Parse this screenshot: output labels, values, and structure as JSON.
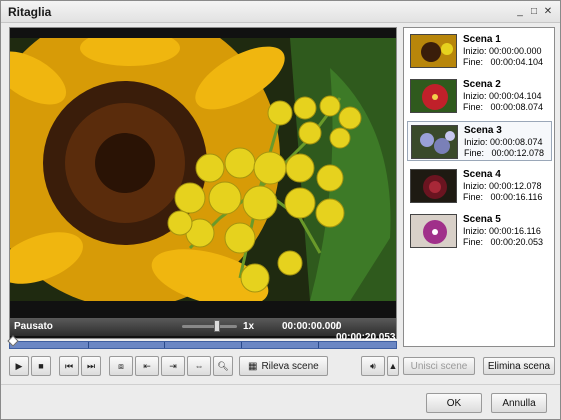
{
  "window": {
    "title": "Ritaglia",
    "buttons": {
      "minimize": "_",
      "maximize": "□",
      "close": "✕"
    }
  },
  "player": {
    "state": "Pausato",
    "speed": "1x",
    "current_time": "00:00:00.000",
    "total_time": "/ 00:00:20.053",
    "speed_level": 0.6
  },
  "controls": {
    "detect_scenes_label": "Rileva scene"
  },
  "scenes": [
    {
      "name": "Scena 1",
      "start": "Inizio: 00:00:00.000",
      "end": "Fine:   00:00:04.104",
      "thumb_color": "#b8860b"
    },
    {
      "name": "Scena 2",
      "start": "Inizio: 00:00:04.104",
      "end": "Fine:   00:00:08.074",
      "thumb_color": "#c0202a"
    },
    {
      "name": "Scena 3",
      "start": "Inizio: 00:00:08.074",
      "end": "Fine:   00:00:12.078",
      "thumb_color": "#7a80b8"
    },
    {
      "name": "Scena 4",
      "start": "Inizio: 00:00:12.078",
      "end": "Fine:   00:00:16.116",
      "thumb_color": "#6a1420"
    },
    {
      "name": "Scena 5",
      "start": "Inizio: 00:00:16.116",
      "end": "Fine:   00:00:20.053",
      "thumb_color": "#a0308a"
    }
  ],
  "scene_actions": {
    "merge_label": "Unisci scene",
    "delete_label": "Elimina scena"
  },
  "dialog": {
    "ok_label": "OK",
    "cancel_label": "Annulla"
  },
  "colors": {
    "timeline": "#6b87c4",
    "selected_scene_border": "#9aa7b8"
  }
}
